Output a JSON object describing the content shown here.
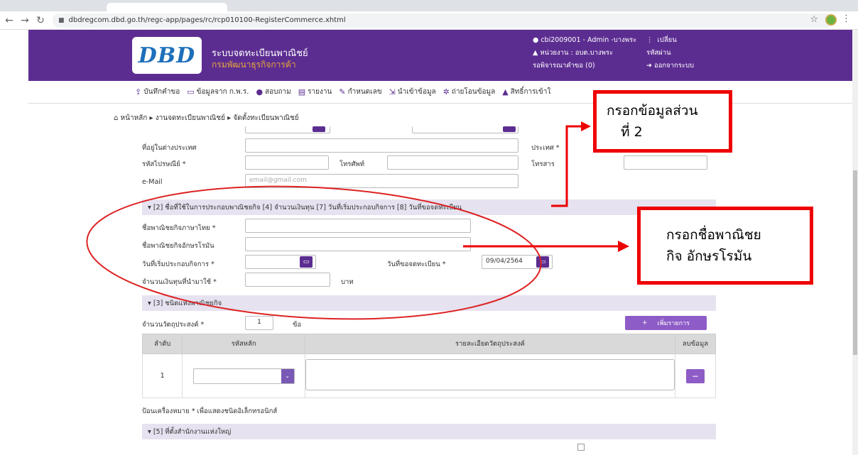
{
  "browser": {
    "url": "dbdregcom.dbd.go.th/regc-app/pages/rc/rcp010100-RegisterCommerce.xhtml"
  },
  "header": {
    "logo": "DBD",
    "brand_line1": "ระบบจดทะเบียนพาณิชย์",
    "brand_line2": "กรมพัฒนาธุรกิจการค้า",
    "user": "cbi2009001 - Admin -บางพระ",
    "change_password": "เปลี่ยนรหัสผ่าน",
    "unit": "หน่วยงาน : อบต.บางพระ",
    "pending": "รอพิจารณาคำขอ (0)",
    "logout": "ออกจากระบบ"
  },
  "menu": [
    "บันทึกคำขอ",
    "ข้อมูลจาก ก.พ.ร.",
    "สอบถาม",
    "รายงาน",
    "กำหนดเลข",
    "นำเข้าข้อมูล",
    "ถ่ายโอนข้อมูล",
    "สิทธิ์การเข้าใ"
  ],
  "breadcrumb": "หน้าหลัก ▸ งานจดทะเบียนพาณิชย์ ▸ จัดตั้งทะเบียนพาณิชย์",
  "section1": {
    "foreign_address": "ที่อยู่ในต่างประเทศ",
    "country": "ประเทศ *",
    "postcode": "รหัสไปรษณีย์ *",
    "phone": "โทรศัพท์",
    "fax": "โทรสาร",
    "email": "e-Mail",
    "email_placeholder": "email@gmail.com"
  },
  "section2": {
    "title": "[2] ชื่อที่ใช้ในการประกอบพาณิชยกิจ [4] จำนวนเงินทุน [7] วันที่เริ่มประกอบกิจการ [8] วันที่ขอจดทะเบียน",
    "name_th": "ชื่อพาณิชยกิจภาษาไทย *",
    "name_en": "ชื่อพาณิชยกิจอักษรโรมัน",
    "start_date": "วันที่เริ่มประกอบกิจการ *",
    "reg_date": "วันที่ขอจดทะเบียน *",
    "reg_date_value": "09/04/2564",
    "capital": "จำนวนเงินทุนที่นำมาใช้ *",
    "baht": "บาท"
  },
  "section3": {
    "title": "[3] ชนิดแห่งพาณิชยกิจ",
    "obj_count_label": "จำนวนวัตถุประสงค์ *",
    "obj_count": "1",
    "unit": "ข้อ",
    "add_button": "เพิ่มรายการ",
    "col_no": "ลำดับ",
    "col_code": "รหัสหลัก",
    "col_detail": "รายละเอียดวัตถุประสงค์",
    "col_delete": "ลบข้อมูล",
    "row_no": "1",
    "note": "ป้อนเครื่องหมาย * เพื่อแสดงชนิดอิเล็กทรอนิกส์"
  },
  "section5": {
    "title": "[5] ที่ตั้งสำนักงานแห่งใหญ่"
  },
  "annotations": {
    "callout1_line1": "กรอกข้อมูลส่วน",
    "callout1_line2": "ที่ 2",
    "callout2_line1": "กรอกชื่อพาณิชย",
    "callout2_line2": "กิจ อักษรโรมัน"
  },
  "colors": {
    "purple": "#5c2d91",
    "annotation_red": "#e00000"
  }
}
